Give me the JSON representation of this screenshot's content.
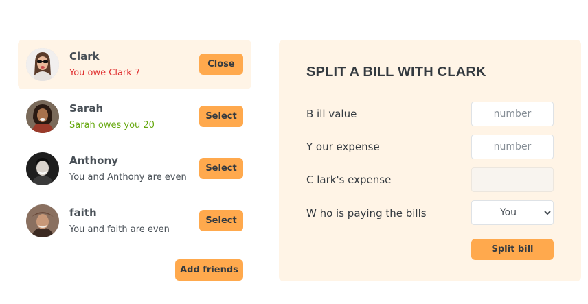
{
  "friends": [
    {
      "name": "Clark",
      "status": "You owe Clark 7",
      "status_kind": "red",
      "button": "Close",
      "selected": true
    },
    {
      "name": "Sarah",
      "status": "Sarah owes you 20",
      "status_kind": "green",
      "button": "Select",
      "selected": false
    },
    {
      "name": "Anthony",
      "status": "You and Anthony are even",
      "status_kind": "neutral",
      "button": "Select",
      "selected": false
    },
    {
      "name": "faith",
      "status": "You and faith are even",
      "status_kind": "neutral",
      "button": "Select",
      "selected": false
    }
  ],
  "add_friends_label": "Add friends",
  "form": {
    "title": "SPLIT A BILL WITH CLARK",
    "bill_label": "B ill value",
    "bill_placeholder": "number",
    "expense_label": "Y our expense",
    "expense_placeholder": "number",
    "friend_expense_label": "C lark's expense",
    "payer_label": "W ho is paying the bills",
    "payer_selected": "You",
    "split_label": "Split bill"
  },
  "colors": {
    "accent": "#ffa94d",
    "panel_bg": "#fff4e6",
    "owe_red": "#e03131",
    "owed_green": "#66a80f"
  },
  "icons": [
    "avatar-clark",
    "avatar-sarah",
    "avatar-anthony",
    "avatar-faith",
    "chevron-down-icon"
  ]
}
